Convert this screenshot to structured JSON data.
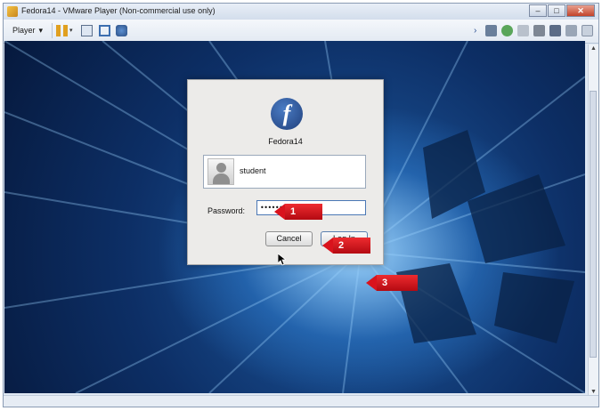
{
  "window": {
    "title": "Fedora14 - VMware Player (Non-commercial use only)",
    "controls": {
      "minimize": "–",
      "maximize": "□",
      "close": "✕"
    }
  },
  "toolbar": {
    "player_label": "Player",
    "player_caret": "▾",
    "icons": [
      "pause-icon",
      "send-ctrl-alt-del-icon",
      "full-screen-icon",
      "unity-icon"
    ],
    "right_icons": [
      "forward-icon",
      "network-icon",
      "usb-icon",
      "hdd-icon",
      "printer-icon",
      "sound-icon",
      "message-icon",
      "close-panel-icon"
    ]
  },
  "login": {
    "hostname": "Fedora14",
    "logo_glyph": "f",
    "username": "student",
    "password_label": "Password:",
    "password_value": "••••••••••••••|",
    "cancel_label": "Cancel",
    "login_label": "Log In"
  },
  "annotations": {
    "step1": "1",
    "step2": "2",
    "step3": "3",
    "color": "#d9131d"
  },
  "scrollbar": {
    "up": "▲",
    "down": "▼"
  }
}
